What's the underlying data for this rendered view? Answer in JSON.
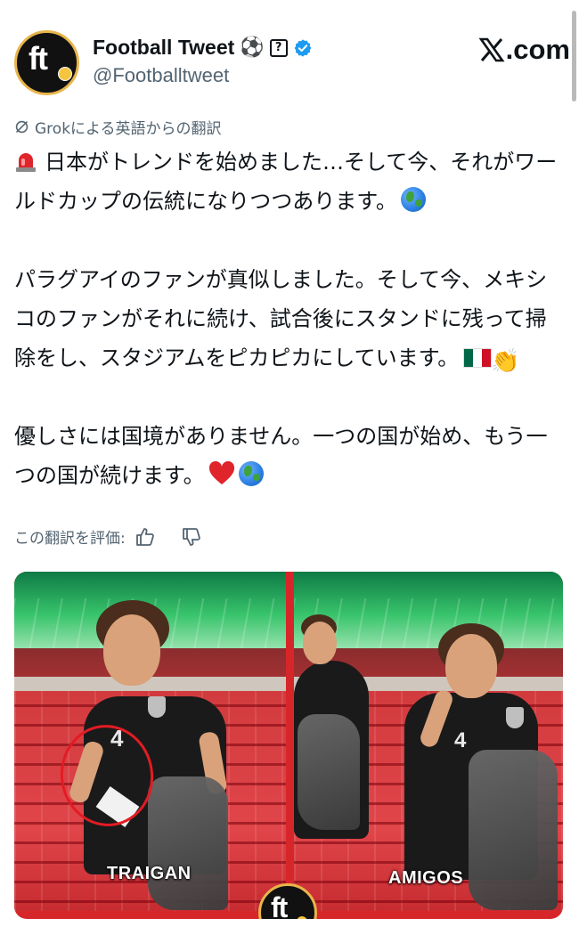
{
  "header": {
    "display_name": "Football Tweet",
    "handle": "@Footballtweet",
    "soccer_emoji": "⚽",
    "unknown_glyph": "?",
    "brand_x": "𝕏",
    "brand_suffix": ".com",
    "avatar_text": "ft"
  },
  "translation": {
    "note": "Grokによる英語からの翻訳"
  },
  "tweet": {
    "line1": "日本がトレンドを始めました…そして今、それがワールドカップの伝統になりつつあります。",
    "paragraph2": "パラグアイのファンが真似しました。そして今、メキシコのファンがそれに続け、試合後にスタンドに残って掃除をし、スタジアムをピカピカにしています。",
    "paragraph3": "優しさには国境がありません。一つの国が始め、もう一つの国が続けます。",
    "clap_emoji": "👏"
  },
  "rating": {
    "label": "この翻訳を評価:"
  },
  "media": {
    "caption_left": "TRAIGAN",
    "caption_right": "AMIGOS",
    "shirt_number_left": "4",
    "shirt_number_right": "4",
    "logo_text": "ft"
  },
  "colors": {
    "text": "#0f1419",
    "secondary": "#536471",
    "verified": "#1d9bf0",
    "siren": "#e0242b",
    "media_divider": "#d7262a",
    "flag_green": "#006847",
    "flag_red": "#ce1126"
  },
  "icons": {
    "grok": "grok-icon",
    "verified": "verified-badge-icon",
    "thumbs_up": "thumbs-up-icon",
    "thumbs_down": "thumbs-down-icon",
    "siren": "rotating-light-emoji",
    "globe": "globe-emoji",
    "flag": "mexico-flag-emoji",
    "heart": "red-heart-emoji"
  }
}
